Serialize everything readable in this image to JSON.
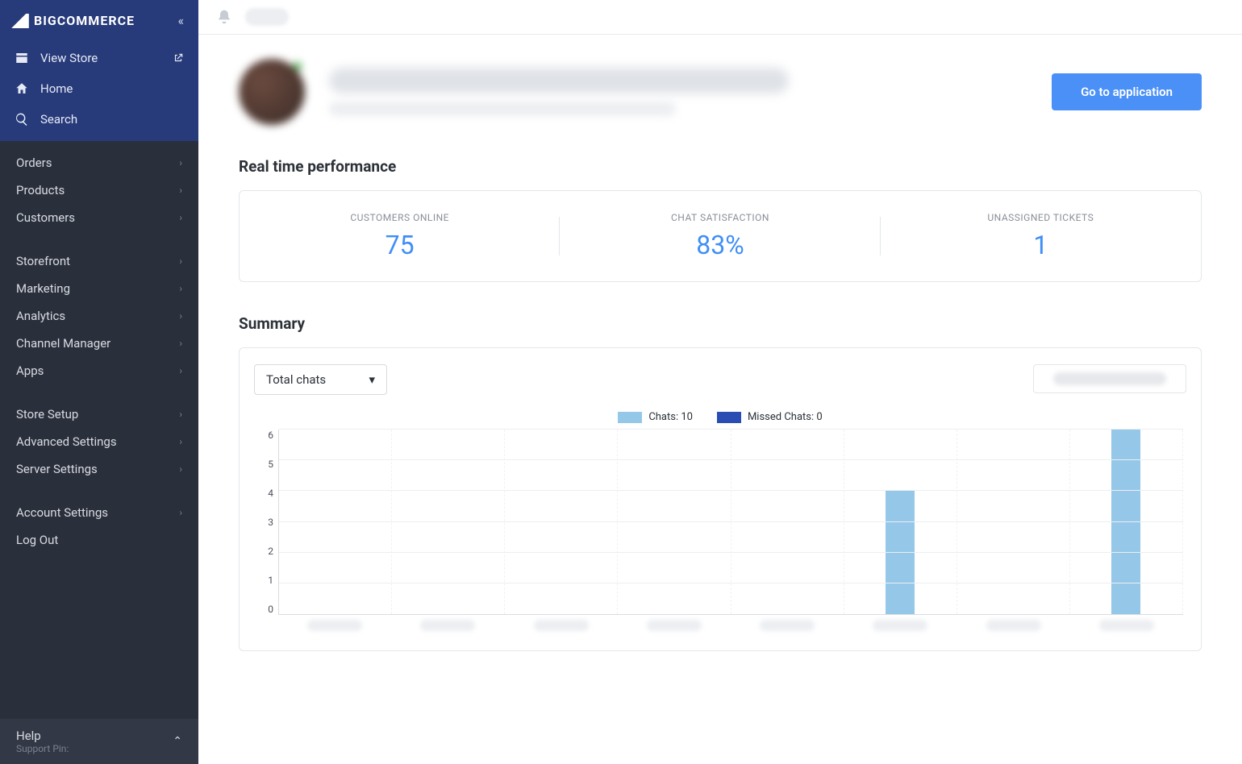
{
  "brand": "BIGCOMMERCE",
  "sidebar": {
    "view_store": "View Store",
    "home": "Home",
    "search": "Search",
    "groups": [
      [
        "Orders",
        "Products",
        "Customers"
      ],
      [
        "Storefront",
        "Marketing",
        "Analytics",
        "Channel Manager",
        "Apps"
      ],
      [
        "Store Setup",
        "Advanced Settings",
        "Server Settings"
      ],
      [
        "Account Settings"
      ]
    ],
    "logout": "Log Out",
    "help": "Help",
    "support_pin": "Support Pin:"
  },
  "header": {
    "go_button": "Go to application"
  },
  "perf": {
    "title": "Real time performance",
    "cells": [
      {
        "label": "CUSTOMERS ONLINE",
        "value": "75"
      },
      {
        "label": "CHAT SATISFACTION",
        "value": "83%"
      },
      {
        "label": "UNASSIGNED TICKETS",
        "value": "1"
      }
    ]
  },
  "summary": {
    "title": "Summary",
    "dropdown": "Total chats",
    "legend_chats": "Chats: 10",
    "legend_missed": "Missed Chats: 0"
  },
  "chart_data": {
    "type": "bar",
    "title": "",
    "ylabel": "",
    "ylim": [
      0,
      6
    ],
    "yticks": [
      0,
      1,
      2,
      3,
      4,
      5,
      6
    ],
    "categories": [
      "",
      "",
      "",
      "",
      "",
      "",
      "",
      ""
    ],
    "series": [
      {
        "name": "Chats",
        "values": [
          0,
          0,
          0,
          0,
          0,
          4,
          0,
          6
        ]
      },
      {
        "name": "Missed Chats",
        "values": [
          0,
          0,
          0,
          0,
          0,
          0,
          0,
          0
        ]
      }
    ],
    "legend_position": "top"
  }
}
